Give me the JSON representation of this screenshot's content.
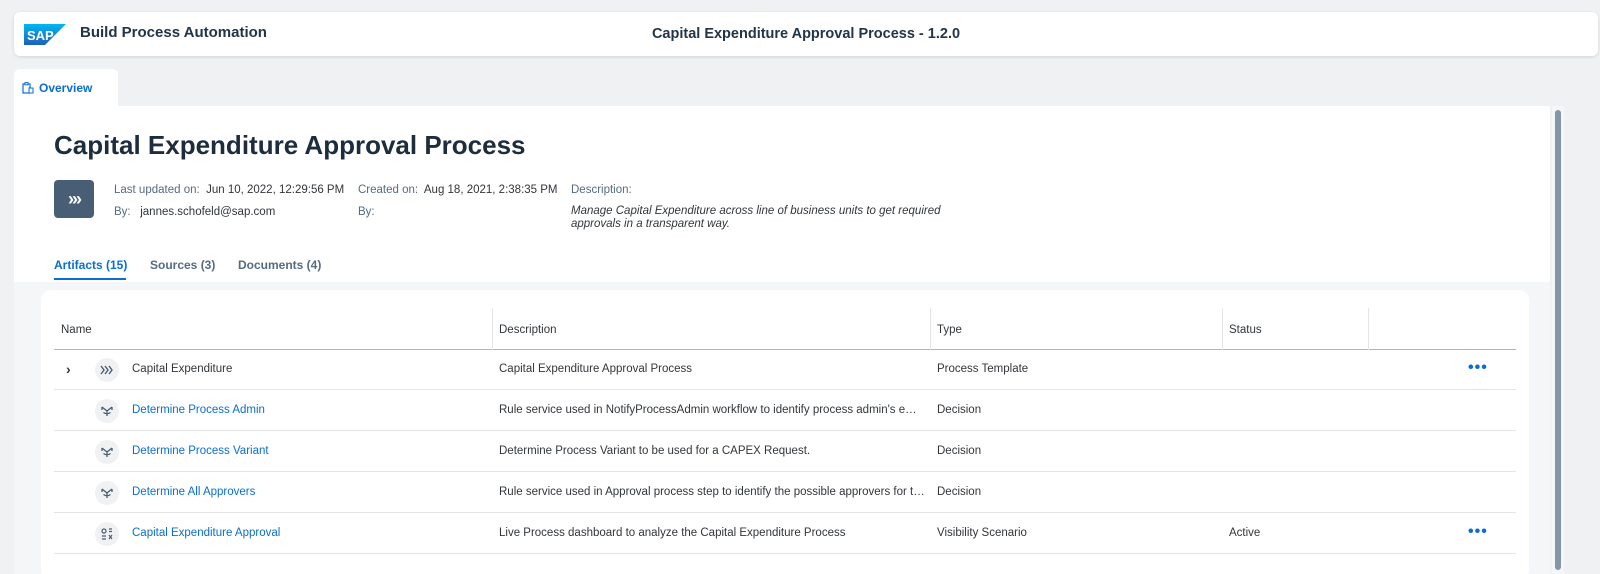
{
  "shell": {
    "logo_text": "SAP",
    "app_name": "Build Process Automation",
    "center_title": "Capital Expenditure Approval Process - 1.2.0"
  },
  "tabs": [
    {
      "label": "Overview",
      "icon": "clipboard-icon"
    }
  ],
  "header": {
    "title": "Capital Expenditure Approval Process",
    "icon": "process-chevrons-icon",
    "last_updated_label": "Last updated on:",
    "last_updated_value": "Jun 10, 2022, 12:29:56 PM",
    "by_label": "By:",
    "by_value": "jannes.schofeld@sap.com",
    "created_label": "Created on:",
    "created_value": "Aug 18, 2021, 2:38:35 PM",
    "created_by_label": "By:",
    "description_label": "Description:",
    "description_value": "Manage Capital Expenditure across line of business units to get required approvals in a transparent way."
  },
  "subtabs": [
    {
      "label": "Artifacts (15)",
      "active": true
    },
    {
      "label": "Sources (3)",
      "active": false
    },
    {
      "label": "Documents (4)",
      "active": false
    }
  ],
  "table": {
    "columns": [
      "Name",
      "Description",
      "Type",
      "Status"
    ],
    "rows": [
      {
        "name": "Capital Expenditure",
        "description": "Capital Expenditure Approval Process",
        "type": "Process Template",
        "status": "",
        "icon": "process-icon",
        "expandable": true,
        "link": false,
        "has_actions": true
      },
      {
        "name": "Determine Process Admin",
        "description": "Rule service used in NotifyProcessAdmin workflow to identify process admin's email address for notification",
        "type": "Decision",
        "status": "",
        "icon": "decision-icon",
        "expandable": false,
        "link": true,
        "has_actions": false
      },
      {
        "name": "Determine Process Variant",
        "description": "Determine Process Variant to be used for a CAPEX Request.",
        "type": "Decision",
        "status": "",
        "icon": "decision-icon",
        "expandable": false,
        "link": true,
        "has_actions": false
      },
      {
        "name": "Determine All Approvers",
        "description": "Rule service used in Approval process step to identify the possible approvers for the request",
        "type": "Decision",
        "status": "",
        "icon": "decision-icon",
        "expandable": false,
        "link": true,
        "has_actions": false
      },
      {
        "name": "Capital Expenditure Approval",
        "description": "Live Process dashboard to analyze the Capital Expenditure Process",
        "type": "Visibility Scenario",
        "status": "Active",
        "icon": "visibility-scenario-icon",
        "expandable": false,
        "link": true,
        "has_actions": true
      }
    ],
    "more_label": "•••",
    "expand_glyph": "›"
  },
  "colors": {
    "accent": "#0a6ed1",
    "title": "#1d2d3e",
    "icon_bg": "#475e75"
  }
}
